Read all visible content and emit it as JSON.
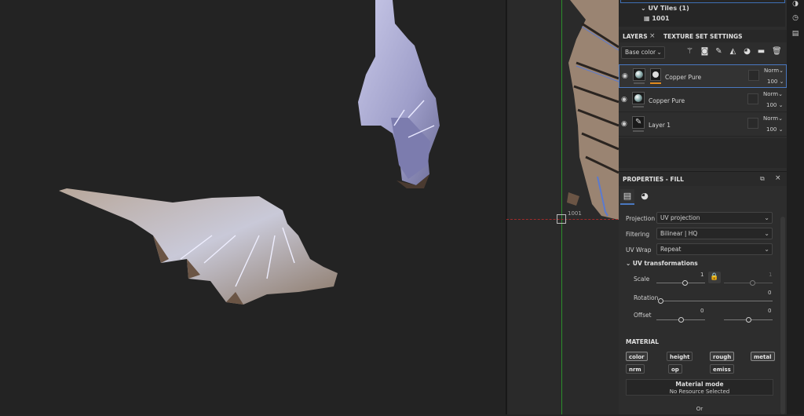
{
  "uv_tiles": {
    "header": "UV Tiles (1)",
    "tile": "1001"
  },
  "viewport_uv": {
    "tile_label": "1001"
  },
  "tabs": {
    "layers": "LAYERS",
    "texture_set_settings": "TEXTURE SET SETTINGS"
  },
  "layer_toolbar": {
    "channel_select": "Base color"
  },
  "layers": [
    {
      "name": "Copper Pure",
      "blend": "Norm",
      "opacity": "100",
      "selected": true
    },
    {
      "name": "Copper Pure",
      "blend": "Norm",
      "opacity": "100",
      "selected": false
    },
    {
      "name": "Layer 1",
      "blend": "Norm",
      "opacity": "100",
      "selected": false
    }
  ],
  "properties": {
    "title": "PROPERTIES - FILL",
    "projection": {
      "label": "Projection",
      "value": "UV projection"
    },
    "filtering": {
      "label": "Filtering",
      "value": "Bilinear | HQ"
    },
    "uv_wrap": {
      "label": "UV Wrap",
      "value": "Repeat"
    },
    "uv_transformations": {
      "header": "UV transformations",
      "scale": {
        "label": "Scale",
        "value_u": "1",
        "value_v": "1"
      },
      "rotation": {
        "label": "Rotation",
        "value": "0"
      },
      "offset": {
        "label": "Offset",
        "value_u": "0",
        "value_v": "0"
      }
    },
    "material": {
      "header": "MATERIAL",
      "channels": [
        {
          "label": "color",
          "active": true
        },
        {
          "label": "height",
          "active": false
        },
        {
          "label": "rough",
          "active": true
        },
        {
          "label": "metal",
          "active": true
        },
        {
          "label": "nrm",
          "active": false
        },
        {
          "label": "op",
          "active": false
        },
        {
          "label": "emiss",
          "active": false
        }
      ],
      "mode_title": "Material mode",
      "mode_value": "No Resource Selected",
      "or": "Or"
    }
  },
  "colors": {
    "accent": "#4a78c0",
    "mask_bar": "#e08a1e",
    "uv_green": "#2b8f2b",
    "uv_red": "#a12a2a"
  }
}
